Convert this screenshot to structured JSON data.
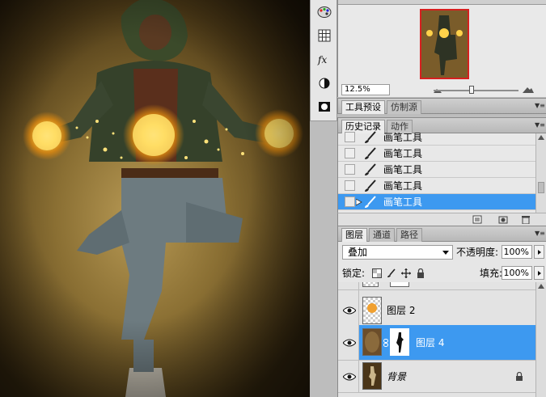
{
  "navigator": {
    "zoom": "12.5%",
    "zoom_fraction": 0.45
  },
  "tool_strip": {
    "icons": [
      "swatches-icon",
      "grid-icon",
      "fx-icon",
      "adjustment-icon",
      "mask-icon"
    ]
  },
  "presets_panel": {
    "tabs": [
      "工具预设",
      "仿制源"
    ]
  },
  "history_panel": {
    "tabs": [
      "历史记录",
      "动作"
    ],
    "items": [
      {
        "label": "画笔工具",
        "selected": false
      },
      {
        "label": "画笔工具",
        "selected": false
      },
      {
        "label": "画笔工具",
        "selected": false
      },
      {
        "label": "画笔工具",
        "selected": false
      },
      {
        "label": "画笔工具",
        "selected": true
      }
    ]
  },
  "layers_panel": {
    "tabs": [
      "图层",
      "通道",
      "路径"
    ],
    "blend_mode": "叠加",
    "opacity_label": "不透明度:",
    "opacity": "100%",
    "lock_label": "锁定:",
    "fill_label": "填充:",
    "fill": "100%",
    "layers": [
      {
        "name": "",
        "visible": false,
        "selected": false,
        "partial": true
      },
      {
        "name": "图层 2",
        "visible": true,
        "selected": false
      },
      {
        "name": "图层 4",
        "visible": true,
        "selected": true,
        "has_mask": true
      },
      {
        "name": "背景",
        "visible": true,
        "selected": false,
        "locked": true
      }
    ]
  },
  "colors": {
    "selection": "#3d99f0",
    "panel_bg": "#e6e6e6",
    "nav_frame": "#d62020"
  }
}
